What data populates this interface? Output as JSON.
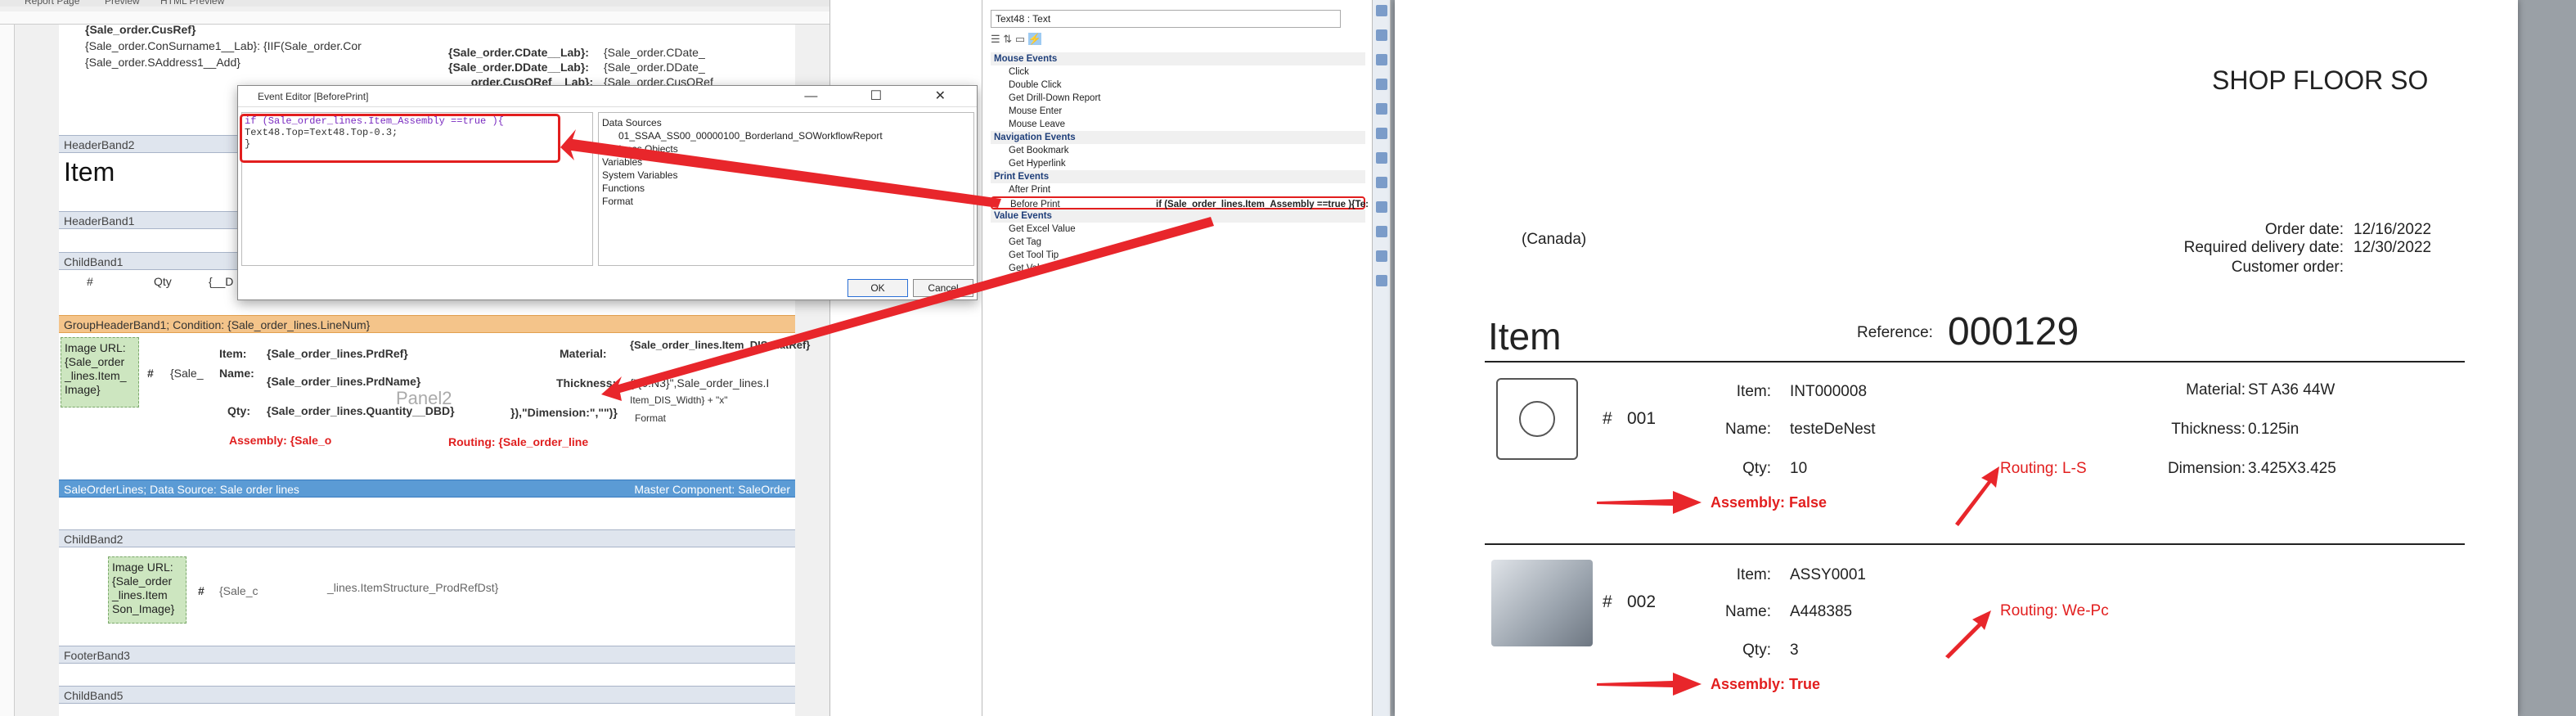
{
  "designer": {
    "tabs": [
      "Report Page",
      "Preview",
      "HTML Preview"
    ],
    "fields_top": {
      "cus_ref": "{Sale_order.CusRef}",
      "con_surname": "{Sale_order.ConSurname1__Lab}: {IIF(Sale_order.Cor",
      "address": "{Sale_order.SAddress1__Add}",
      "cdate_lab": "{Sale_order.CDate__Lab}:",
      "cdate_val": "{Sale_order.CDate_",
      "ddate_lab": "{Sale_order.DDate__Lab}:",
      "ddate_val": "{Sale_order.DDate_",
      "cusqref_lab": "_order.CusQRef__Lab}:",
      "cusqref_val": "{Sale_order.CusQRef"
    },
    "header_band2": "HeaderBand2",
    "item_label": "Item",
    "header_band1": "HeaderBand1",
    "child_band1": "ChildBand1",
    "cols": {
      "hash": "#",
      "qty": "Qty",
      "c3": "{__D"
    },
    "group_header": "GroupHeaderBand1; Condition: {Sale_order_lines.LineNum}",
    "image_url_1": "Image URL: {Sale_order _lines.Item_ Image}",
    "hash": "#",
    "sale_abbrev": "{Sale_",
    "item_lab": "Item:",
    "item_val": "{Sale_order_lines.PrdRef}",
    "name_lab": "Name:",
    "name_val": "{Sale_order_lines.PrdName}",
    "qty_lab": "Qty:",
    "qty_val": "{Sale_order_lines.Quantity__DBD}",
    "material_lab": "Material:",
    "material_val": "{Sale_order_lines.Item_DIS MatRef}",
    "thickness_lab": "Thickness:",
    "thickness_val": "{\"{0:N3}\",Sale_order_lines.I",
    "dimension_val": "}),\"Dimension:\",\"\")}",
    "dim_extra": "Item_DIS_Width} + \"x\"",
    "format_lab": "Format",
    "panel": "Panel2",
    "assembly": "Assembly: {Sale_o",
    "routing": "Routing: {Sale_order_line",
    "data_band": "SaleOrderLines; Data Source: Sale order lines",
    "master": "Master Component: SaleOrder",
    "child_band2": "ChildBand2",
    "image_url_2": "Image URL: {Sale_order _lines.Item Son_Image}",
    "hash2": "#",
    "sale_c": "{Sale_c",
    "structure": "_lines.ItemStructure_ProdRefDst}",
    "footer_band3": "FooterBand3",
    "child_band5": "ChildBand5"
  },
  "event_editor": {
    "title": "Event Editor [BeforePrint]",
    "code_line1": "if (Sale_order_lines.Item_Assembly ==true ){",
    "code_line2": "Text48.Top=Text48.Top-0.3;",
    "code_line3": "}",
    "tree": [
      "Data Sources",
      "01_SSAA_SS00_00000100_Borderland_SOWorkflowReport",
      "Business Objects",
      "Variables",
      "System Variables",
      "Functions",
      "Format"
    ],
    "ok": "OK",
    "cancel": "Cancel",
    "win_buttons": "— ☐ ✕"
  },
  "properties": {
    "selected": "Text48 : Text",
    "rows": [
      {
        "cat": true,
        "k": "Mouse Events"
      },
      {
        "k": "Click",
        "v": ""
      },
      {
        "k": "Double Click",
        "v": ""
      },
      {
        "k": "Get Drill-Down Report",
        "v": ""
      },
      {
        "k": "Mouse Enter",
        "v": ""
      },
      {
        "k": "Mouse Leave",
        "v": ""
      },
      {
        "cat": true,
        "k": "Navigation Events"
      },
      {
        "k": "Get Bookmark",
        "v": ""
      },
      {
        "k": "Get Hyperlink",
        "v": ""
      },
      {
        "cat": true,
        "k": "Print Events"
      },
      {
        "k": "After Print",
        "v": ""
      },
      {
        "k": "Before Print",
        "v": "if (Sale_order_lines.Item_Assembly ==true ){Te:",
        "sel": true
      },
      {
        "cat": true,
        "k": "Value Events"
      },
      {
        "k": "Get Excel Value",
        "v": ""
      },
      {
        "k": "Get Tag",
        "v": ""
      },
      {
        "k": "Get Tool Tip",
        "v": ""
      },
      {
        "k": "Get Value",
        "v": ""
      }
    ]
  },
  "preview": {
    "shop_title": "SHOP FLOOR SO",
    "country": "(Canada)",
    "order_date_lab": "Order date:",
    "order_date": "12/16/2022",
    "delivery_lab": "Required delivery date:",
    "delivery": "12/30/2022",
    "customer_lab": "Customer order:",
    "item_head": "Item",
    "reference_lab": "Reference:",
    "reference": "000129",
    "lines": [
      {
        "hash": "#",
        "num": "001",
        "item_lab": "Item:",
        "item": "INT000008",
        "name_lab": "Name:",
        "name": "testeDeNest",
        "qty_lab": "Qty:",
        "qty": "10",
        "material_lab": "Material:",
        "material": "ST A36 44W",
        "thickness_lab": "Thickness:",
        "thickness": "0.125in",
        "dimension_lab": "Dimension:",
        "dimension": "3.425X3.425",
        "routing": "Routing: L-S",
        "assembly": "Assembly: False"
      },
      {
        "hash": "#",
        "num": "002",
        "item_lab": "Item:",
        "item": "ASSY0001",
        "name_lab": "Name:",
        "name": "A448385",
        "qty_lab": "Qty:",
        "qty": "3",
        "routing": "Routing: We-Pc",
        "assembly": "Assembly: True"
      }
    ]
  },
  "colors": {
    "accent_red": "#e21e1e",
    "band_orange": "#f4c48a",
    "band_blue": "#5b9bd5"
  }
}
